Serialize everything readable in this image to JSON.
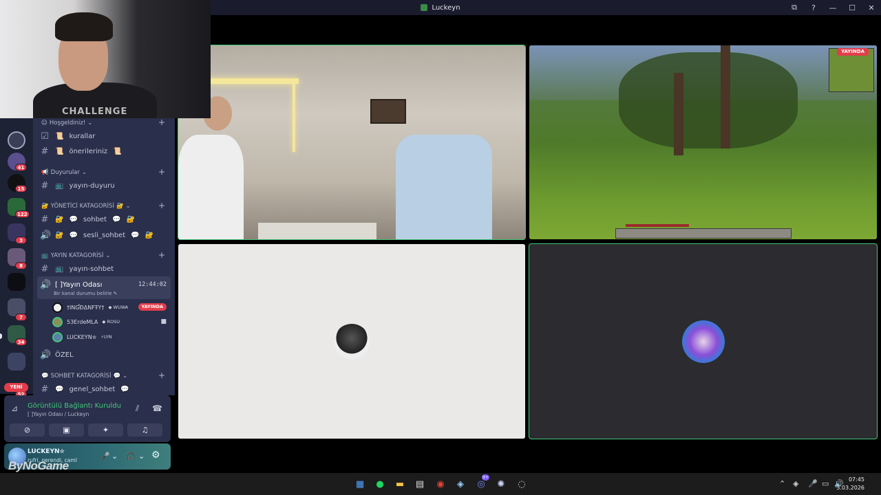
{
  "window": {
    "title": "Luckeyn"
  },
  "servers": {
    "badges": [
      "41",
      "15",
      "122",
      "3",
      "8",
      "7",
      "34",
      "52"
    ],
    "new_label": "YENİ"
  },
  "channels": {
    "cat1": "Hoşgeldiniz!",
    "kurallar": "kurallar",
    "onerileriniz": "önerileriniz",
    "cat2": "Duyurular",
    "yayin_duyuru": "yayın-duyuru",
    "cat3": "YÖNETİCİ KATAGORİSİ",
    "sohbet": "sohbet",
    "sesli_sohbet": "sesli_sohbet",
    "cat4": "YAYIN KATAGORİSİ",
    "yayin_sohbet": "yayın-sohbet",
    "yayin_odasi": "[ ]Yayın Odası",
    "yayin_odasi_time": "12:44:02",
    "yayin_odasi_status": "Bir kanal durumu belirle",
    "ozel": "ÖZEL",
    "cat5": "SOHBET KATAGORİSİ",
    "genel_sohbet": "genel_sohbet"
  },
  "members": [
    {
      "name": "†INƓĐΔΝFŦY†",
      "tag": "WUWA",
      "live": "YAYINDA"
    },
    {
      "name": "53ErdeMLA",
      "tag": "ROSU"
    },
    {
      "name": "LUCKEYN✮",
      "tag": "LYN"
    }
  ],
  "voice": {
    "title": "Görüntülü Bağlantı Kuruldu",
    "subtitle": "[ ]Yayın Odası / Luckeyn"
  },
  "user": {
    "name": "LUCKEYN✮",
    "status": "rufri, gerendi, caml"
  },
  "overlay": {
    "brand": "ByNoGame",
    "shirt": "CHALLENGE"
  },
  "tiles": {
    "live_label": "YAYINDA"
  },
  "clock": {
    "time": "07:45",
    "date": "3.03.2026"
  },
  "taskbar": {
    "discord_badge": "9+"
  }
}
